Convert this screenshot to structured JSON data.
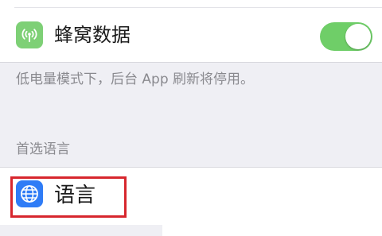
{
  "cellular": {
    "label": "蜂窝数据",
    "icon": "cellular-antenna-icon",
    "icon_color": "#7ed076",
    "toggle_on": true,
    "toggle_color": "#6fce68"
  },
  "footnote": "低电量模式下，后台 App 刷新将停用。",
  "preferred_language": {
    "section_header": "首选语言",
    "label": "语言",
    "icon": "globe-icon",
    "icon_color": "#2f7cf6"
  },
  "highlight": {
    "target": "language-row",
    "color": "#d7262d"
  }
}
